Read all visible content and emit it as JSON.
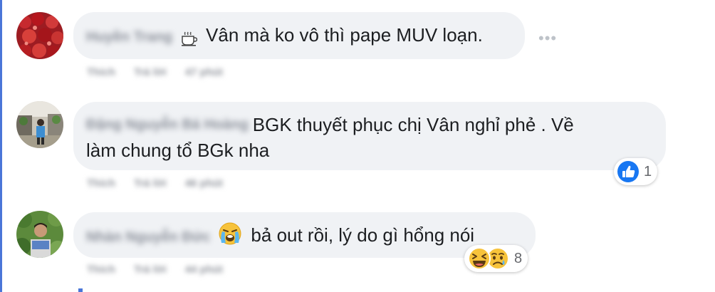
{
  "comments": [
    {
      "author": "Huyền Trang",
      "text": "Vân mà ko vô thì pape MUV loạn.",
      "leading_icon": "coffee-cup-icon",
      "meta": [
        "Thích",
        "Trả lời",
        "47 phút"
      ],
      "more_label": "•••"
    },
    {
      "author": "Đặng Nguyễn Bá Hoàng",
      "text_line1": "BGK thuyết phục chị Vân nghỉ phẻ . Về",
      "text_line2": "làm chung tổ BGk nha",
      "meta": [
        "Thích",
        "Trả lời",
        "46 phút"
      ],
      "reactions": {
        "icons": [
          "like-icon"
        ],
        "count": "1"
      }
    },
    {
      "author": "Nhàn Nguyễn Đức",
      "text": "bả out rồi, lý do gì hổng nói",
      "leading_icon": "crying-face-icon",
      "meta": [
        "Thích",
        "Trả lời",
        "44 phút"
      ],
      "reactions": {
        "icons": [
          "laughing-face-icon",
          "sad-face-icon"
        ],
        "count": "8"
      }
    }
  ],
  "colors": {
    "bubble": "#f0f2f5",
    "accent": "#4a76d8",
    "like_blue": "#1877f2",
    "emoji_yellow": "#f7c33b"
  }
}
